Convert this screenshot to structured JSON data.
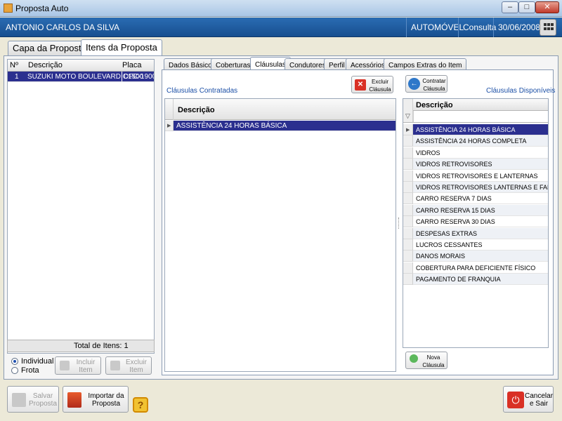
{
  "window": {
    "title": "Proposta Auto"
  },
  "header": {
    "user": "ANTONIO CARLOS DA SILVA",
    "type": "AUTOMÓVEL",
    "mode": "Consulta",
    "date": "30/06/2008"
  },
  "main_tabs": [
    {
      "label": "Capa da Proposta"
    },
    {
      "label": "Itens da Proposta"
    }
  ],
  "items_grid": {
    "columns": [
      "Nº",
      "Descrição",
      "Placa"
    ],
    "rows": [
      {
        "num": "1",
        "desc": "SUZUKI MOTO BOULEVARD C1500",
        "plate": "DFC-1900"
      }
    ],
    "total": "Total de Itens: 1"
  },
  "radio": {
    "individual": "Individual",
    "frota": "Frota"
  },
  "left_buttons": {
    "incluir": "Incluir\nItem",
    "excluir": "Excluir\nItem"
  },
  "sub_tabs": [
    "Dados Básicos",
    "Coberturas",
    "Cláusulas",
    "Condutores",
    "Perfil",
    "Acessórios",
    "Campos Extras do Item"
  ],
  "contracted": {
    "title": "Cláusulas Contratadas",
    "exclude_button": "Excluir\nCláusula",
    "column": "Descrição",
    "rows": [
      "ASSISTÊNCIA 24 HORAS BÁSICA"
    ]
  },
  "available": {
    "title": "Cláusulas Disponíveis",
    "contract_button": "Contratar\nCláusula",
    "column": "Descrição",
    "new_button": "Nova\nCláusula",
    "rows": [
      "ASSISTÊNCIA 24 HORAS BÁSICA",
      "ASSISTÊNCIA 24 HORAS COMPLETA",
      "VIDROS",
      "VIDROS RETROVISORES",
      "VIDROS RETROVISORES E LANTERNAS",
      "VIDROS RETROVISORES LANTERNAS E FAROIS",
      "CARRO RESERVA 7 DIAS",
      "CARRO RESERVA 15 DIAS",
      "CARRO RESERVA 30 DIAS",
      "DESPESAS EXTRAS",
      "LUCROS CESSANTES",
      "DANOS MORAIS",
      "COBERTURA PARA DEFICIENTE FÍSICO",
      "PAGAMENTO DE FRANQUIA"
    ]
  },
  "bottom": {
    "save": "Salvar\nProposta",
    "import": "Importar da\nProposta",
    "exit": "Cancelar\ne Sair",
    "help": "?"
  }
}
